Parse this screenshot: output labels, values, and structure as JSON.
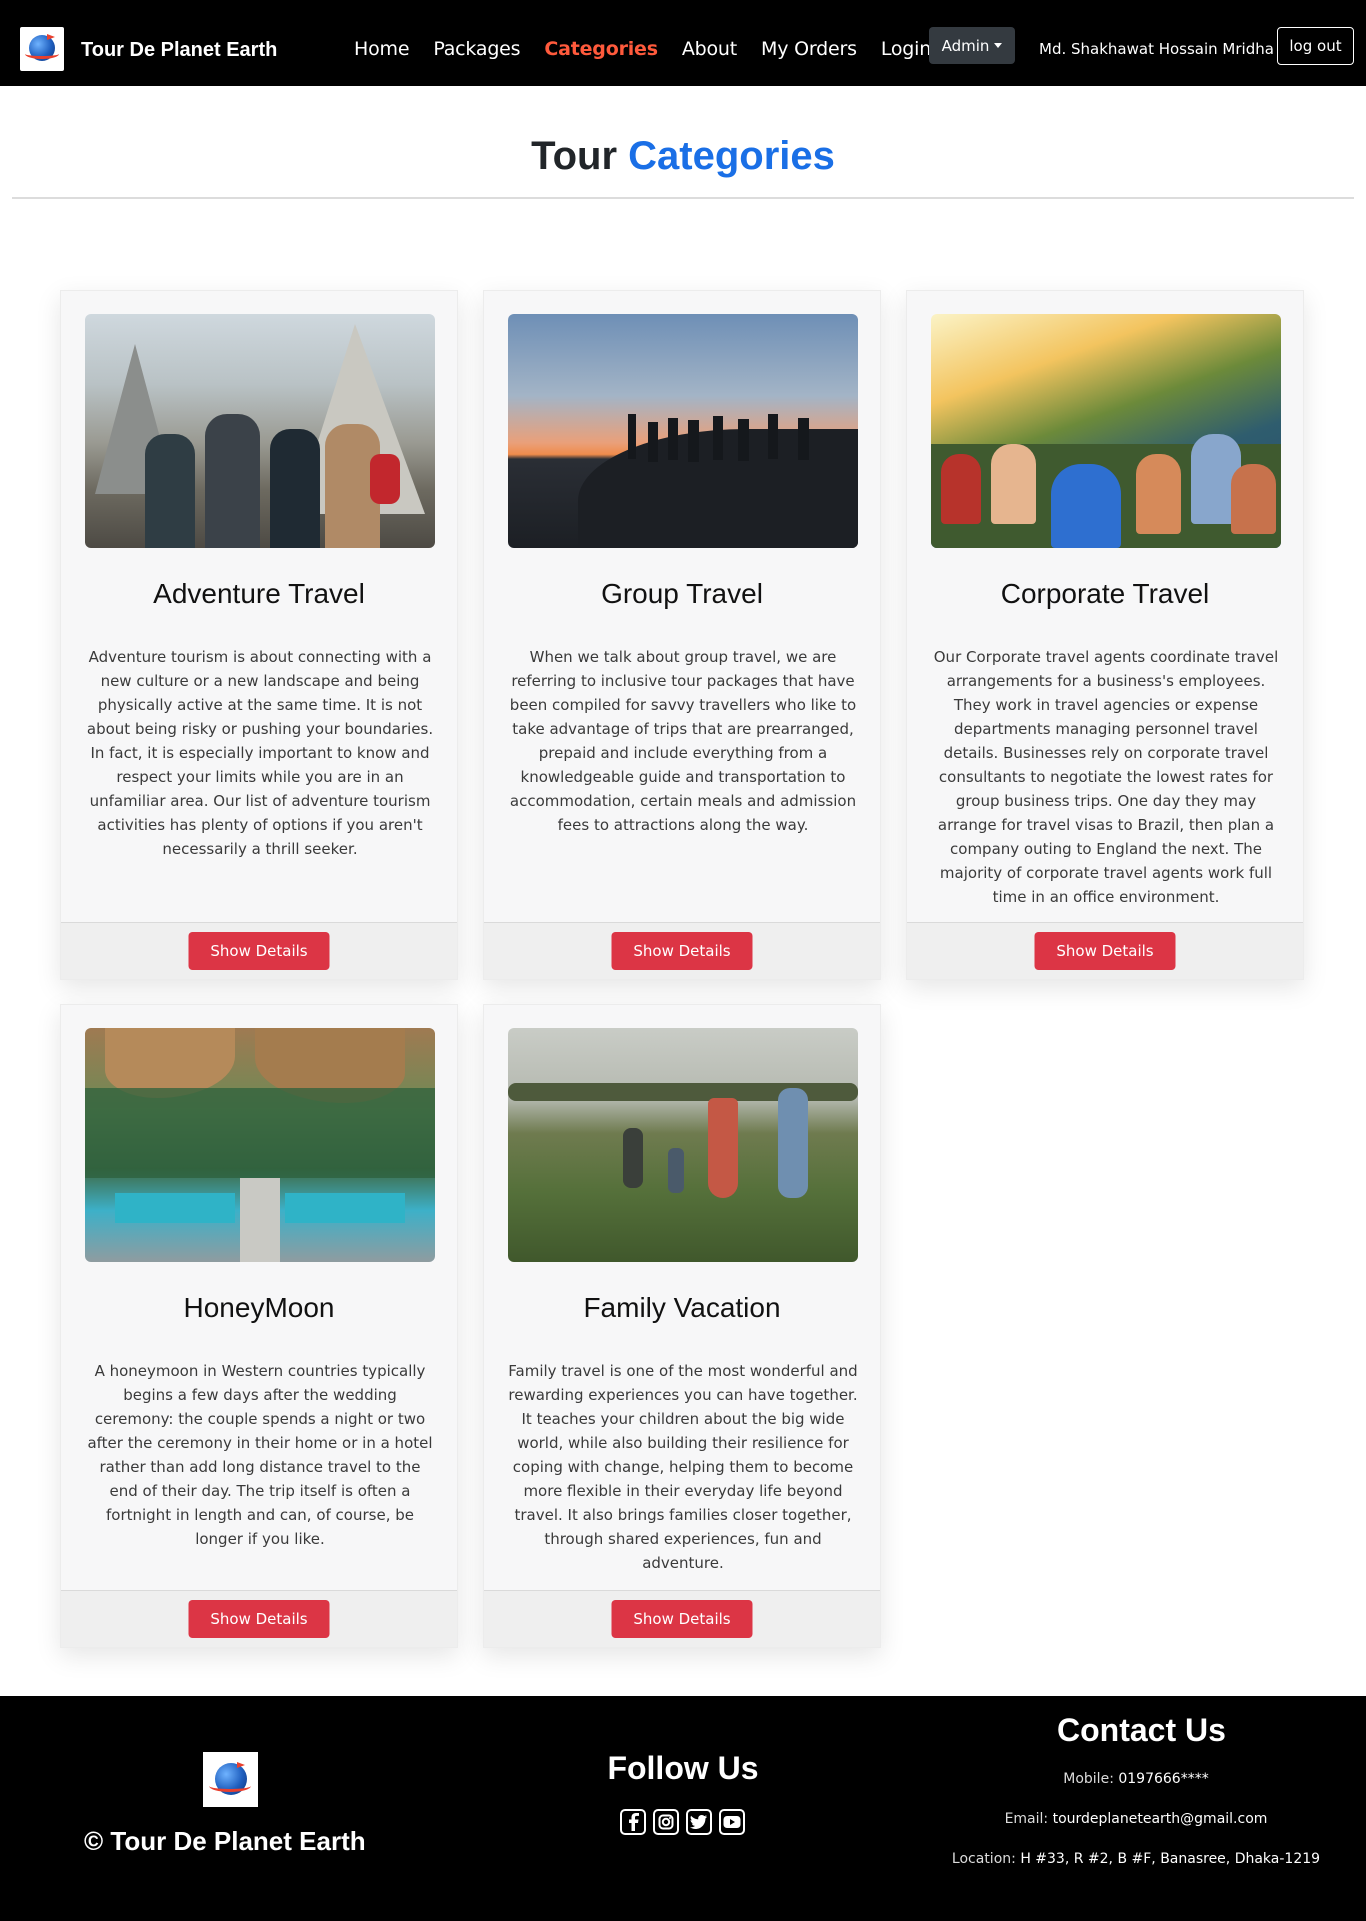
{
  "navbar": {
    "brand": "Tour De Planet Earth",
    "links": [
      "Home",
      "Packages",
      "Categories",
      "About",
      "My Orders",
      "Login"
    ],
    "active": "Categories",
    "admin_label": "Admin",
    "user_name": "Md. Shakhawat Hossain Mridha",
    "logout_label": "log out"
  },
  "page": {
    "title_main": "Tour",
    "title_accent": "Categories",
    "accent_color": "#1a6fe6"
  },
  "cards": [
    {
      "title": "Adventure Travel",
      "text": "Adventure tourism is about connecting with a new culture or a new landscape and being physically active at the same time. It is not about being risky or pushing your boundaries. In fact, it is especially important to know and respect your limits while you are in an unfamiliar area. Our list of adventure tourism activities has plenty of options if you aren't necessarily a thrill seeker.",
      "button": "Show Details",
      "image": "adventure-group-photo"
    },
    {
      "title": "Group Travel",
      "text": "When we talk about group travel, we are referring to inclusive tour packages that have been compiled for savvy travellers who like to take advantage of trips that are prearranged, prepaid and include everything from a knowledgeable guide and transportation to accommodation, certain meals and admission fees to attractions along the way.",
      "button": "Show Details",
      "image": "group-sunset-silhouette"
    },
    {
      "title": "Corporate Travel",
      "text": "Our Corporate travel agents coordinate travel arrangements for a business's employees. They work in travel agencies or expense departments managing personnel travel details. Businesses rely on corporate travel consultants to negotiate the lowest rates for group business trips. One day they may arrange for travel visas to Brazil, then plan a company outing to England the next. The majority of corporate travel agents work full time in an office environment.",
      "button": "Show Details",
      "image": "corporate-hillside-gathering"
    },
    {
      "title": "HoneyMoon",
      "text": "A honeymoon in Western countries typically begins a few days after the wedding ceremony: the couple spends a night or two after the ceremony in their home or in a hotel rather than add long distance travel to the end of their day. The trip itself is often a fortnight in length and can, of course, be longer if you like.",
      "button": "Show Details",
      "image": "resort-pool-palms"
    },
    {
      "title": "Family Vacation",
      "text": "Family travel is one of the most wonderful and rewarding experiences you can have together. It teaches your children about the big wide world, while also building their resilience for coping with change, helping them to become more flexible in their everyday life beyond travel. It also brings families closer together, through shared experiences, fun and adventure.",
      "button": "Show Details",
      "image": "family-in-field"
    }
  ],
  "footer": {
    "copyright": "© Tour De Planet Earth",
    "follow_title": "Follow Us",
    "social_icons": [
      "facebook-icon",
      "instagram-icon",
      "twitter-icon",
      "youtube-icon"
    ],
    "contact_title": "Contact Us",
    "mobile_label": "Mobile:",
    "mobile_value": "0197666****",
    "email_label": "Email:",
    "email_value": "tourdeplanetearth@gmail.com",
    "location_label": "Location:",
    "location_value": "H #33, R #2, B #F, Banasree, Dhaka-1219"
  },
  "colors": {
    "navbar_bg": "#000000",
    "active_link": "#ff5a3c",
    "button_red": "#dc3545",
    "card_bg": "#f7f7f8"
  }
}
